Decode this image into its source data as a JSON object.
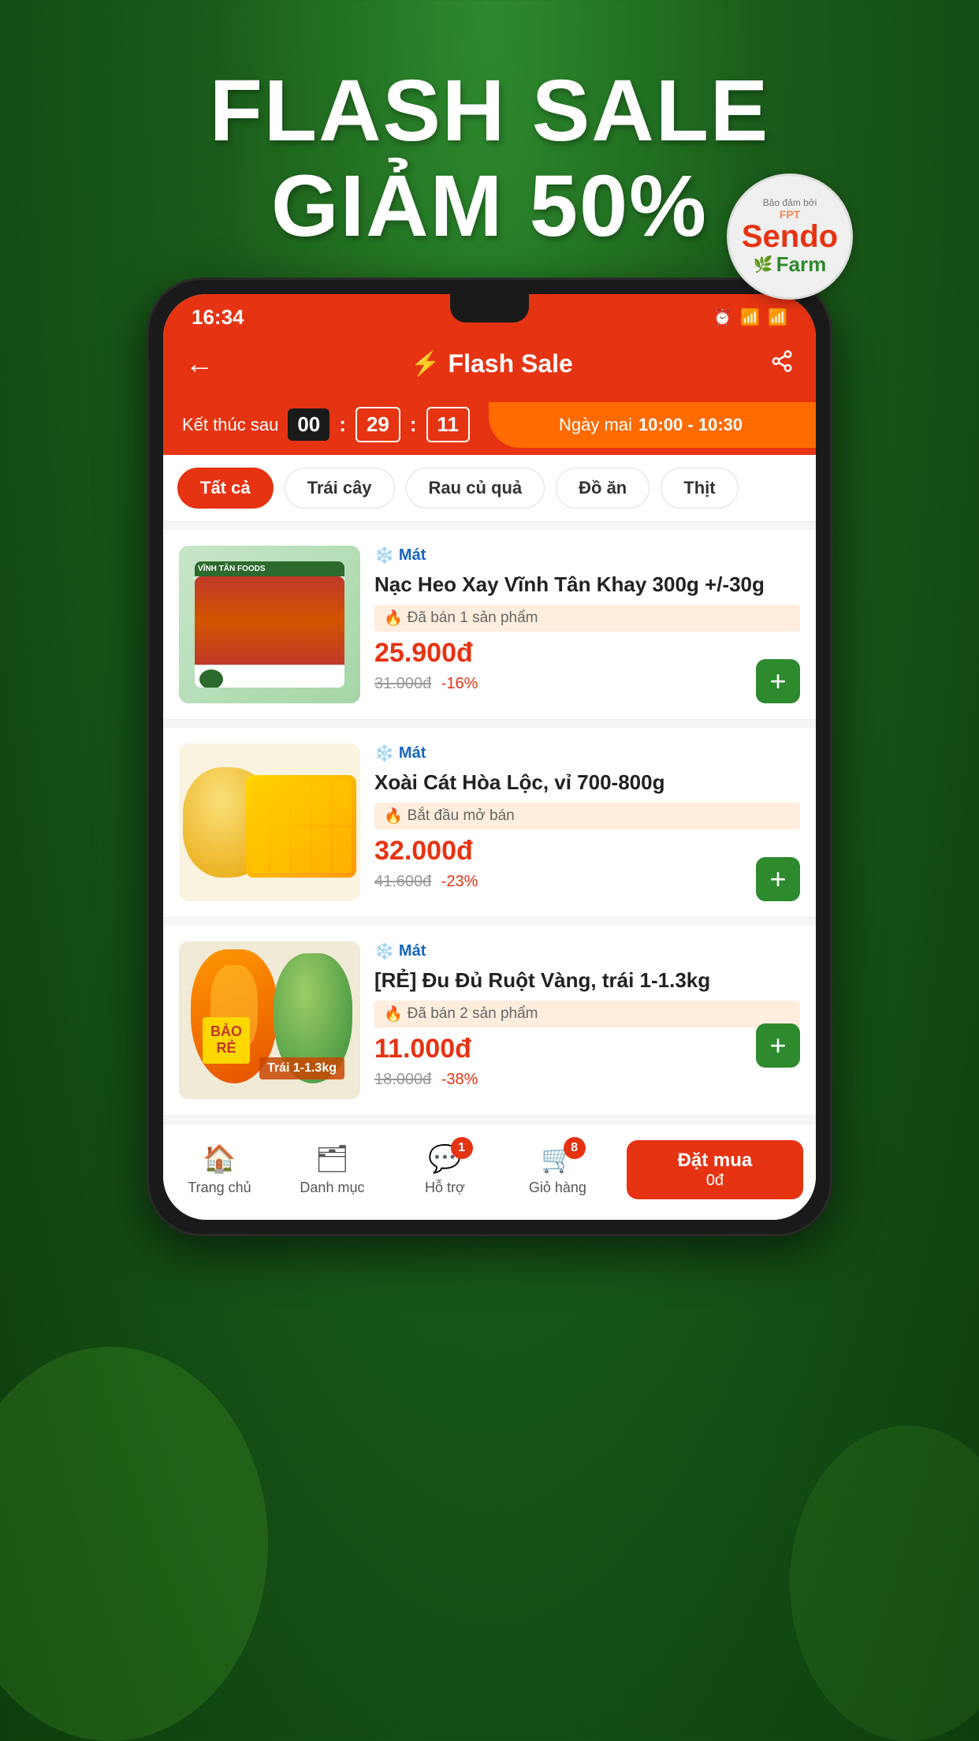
{
  "background": {
    "gradient_top": "#2d8a2d",
    "gradient_bottom": "#0d3d0d"
  },
  "promo": {
    "headline_line1": "FLASH SALE",
    "headline_line2": "GIẢM 50%"
  },
  "logo": {
    "guarantee_label": "Bảo đảm bởi",
    "brand_name": "Sendo",
    "brand_sub": "Farm"
  },
  "status_bar": {
    "time": "16:34",
    "icons": "⏰ 📶 📶"
  },
  "app_header": {
    "back_label": "←",
    "title": "Flash Sale",
    "share_icon": "share"
  },
  "timer": {
    "label": "Kết thúc sau",
    "hours": "00",
    "minutes": "29",
    "seconds": "11",
    "next_label": "Ngày mai",
    "next_time": "10:00 - 10:30"
  },
  "categories": [
    {
      "id": "all",
      "label": "Tất cả",
      "active": true
    },
    {
      "id": "fruit",
      "label": "Trái cây",
      "active": false
    },
    {
      "id": "veg",
      "label": "Rau củ quả",
      "active": false
    },
    {
      "id": "food",
      "label": "Đồ ăn",
      "active": false
    },
    {
      "id": "meat",
      "label": "Thịt",
      "active": false
    }
  ],
  "products": [
    {
      "id": "p1",
      "badge": "Mát",
      "name": "Nạc Heo Xay Vĩnh Tân Khay 300g +/-30g",
      "sold": "Đã bán 1 sản phẩm",
      "price": "25.900đ",
      "original_price": "31.000đ",
      "discount": "-16%",
      "type": "meat"
    },
    {
      "id": "p2",
      "badge": "Mát",
      "name": "Xoài Cát Hòa Lộc, vỉ 700-800g",
      "sold": "Bắt đầu mở bán",
      "price": "32.000đ",
      "original_price": "41.600đ",
      "discount": "-23%",
      "type": "mango"
    },
    {
      "id": "p3",
      "badge": "Mát",
      "name": "[RẺ] Đu Đủ Ruột Vàng, trái 1-1.3kg",
      "sold": "Đã bán 2 sản phẩm",
      "price": "11.000đ",
      "original_price": "18.000đ",
      "discount": "-38%",
      "bao_re": "BẢO RẺ",
      "trai_label": "Trái 1-1.3kg",
      "type": "papaya"
    }
  ],
  "bottom_nav": [
    {
      "id": "home",
      "icon": "🏠",
      "label": "Trang chủ",
      "badge": null
    },
    {
      "id": "categories",
      "icon": "🗂",
      "label": "Danh mục",
      "badge": null
    },
    {
      "id": "support",
      "icon": "💬",
      "label": "Hỗ trợ",
      "badge": "1"
    },
    {
      "id": "cart",
      "icon": "🛒",
      "label": "Giỏ hàng",
      "badge": "8"
    }
  ],
  "buy_button": {
    "label": "Đặt mua",
    "price": "0đ"
  }
}
